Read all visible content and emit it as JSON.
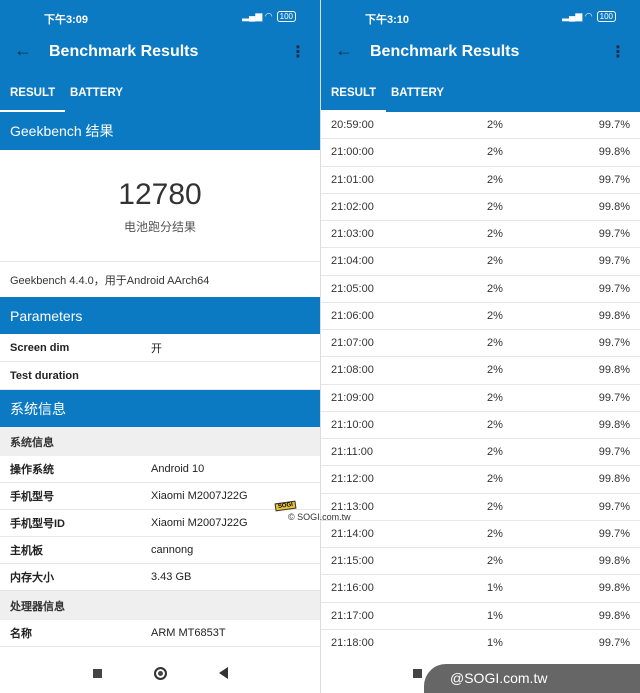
{
  "left": {
    "status_time": "下午3:09",
    "battery": "100",
    "title": "Benchmark Results",
    "tabs": [
      "RESULT",
      "BATTERY"
    ],
    "section1": "Geekbench 结果",
    "score": "12780",
    "score_label": "电池跑分结果",
    "info": "Geekbench 4.4.0，用于Android AArch64",
    "params_title": "Parameters",
    "params": [
      {
        "k": "Screen dim",
        "v": "开"
      },
      {
        "k": "Test duration",
        "v": ""
      }
    ],
    "sys_title": "系统信息",
    "sys_sub": "系统信息",
    "sys": [
      {
        "k": "操作系统",
        "v": "Android 10"
      },
      {
        "k": "手机型号",
        "v": "Xiaomi M2007J22G"
      },
      {
        "k": "手机型号ID",
        "v": "Xiaomi M2007J22G"
      },
      {
        "k": "主机板",
        "v": "cannong"
      },
      {
        "k": "内存大小",
        "v": "3.43 GB"
      }
    ],
    "cpu_sub": "处理器信息",
    "cpu": [
      {
        "k": "名称",
        "v": "ARM MT6853T"
      }
    ]
  },
  "right": {
    "status_time": "下午3:10",
    "battery": "100",
    "title": "Benchmark Results",
    "tabs": [
      "RESULT",
      "BATTERY"
    ],
    "rows": [
      [
        "20:59:00",
        "2%",
        "99.7%"
      ],
      [
        "21:00:00",
        "2%",
        "99.8%"
      ],
      [
        "21:01:00",
        "2%",
        "99.7%"
      ],
      [
        "21:02:00",
        "2%",
        "99.8%"
      ],
      [
        "21:03:00",
        "2%",
        "99.7%"
      ],
      [
        "21:04:00",
        "2%",
        "99.7%"
      ],
      [
        "21:05:00",
        "2%",
        "99.7%"
      ],
      [
        "21:06:00",
        "2%",
        "99.8%"
      ],
      [
        "21:07:00",
        "2%",
        "99.7%"
      ],
      [
        "21:08:00",
        "2%",
        "99.8%"
      ],
      [
        "21:09:00",
        "2%",
        "99.7%"
      ],
      [
        "21:10:00",
        "2%",
        "99.8%"
      ],
      [
        "21:11:00",
        "2%",
        "99.7%"
      ],
      [
        "21:12:00",
        "2%",
        "99.8%"
      ],
      [
        "21:13:00",
        "2%",
        "99.7%"
      ],
      [
        "21:14:00",
        "2%",
        "99.7%"
      ],
      [
        "21:15:00",
        "2%",
        "99.8%"
      ],
      [
        "21:16:00",
        "1%",
        "99.8%"
      ],
      [
        "21:17:00",
        "1%",
        "99.8%"
      ],
      [
        "21:18:00",
        "1%",
        "99.7%"
      ]
    ]
  },
  "watermark": "@SOGI.com.tw",
  "watermark_small": "© SOGI.com.tw",
  "logo_text": "SOGI",
  "colors": {
    "primary": "#0b7ac3",
    "icon_dark": "#1b2e45"
  }
}
